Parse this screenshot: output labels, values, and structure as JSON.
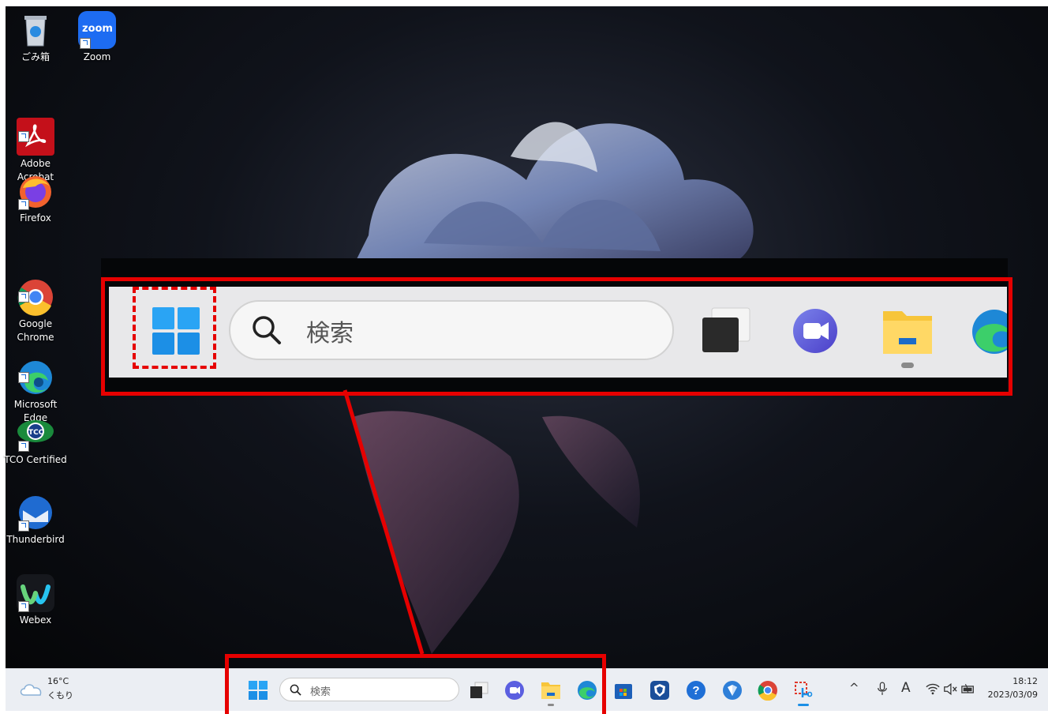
{
  "desktop_icons": [
    {
      "name": "recycle-bin",
      "label": "ごみ箱"
    },
    {
      "name": "zoom",
      "label": "Zoom",
      "badge": "zoom"
    },
    {
      "name": "adobe-acrobat",
      "label": "Adobe\nAcrobat"
    },
    {
      "name": "firefox",
      "label": "Firefox"
    },
    {
      "name": "google-chrome",
      "label": "Google\nChrome"
    },
    {
      "name": "microsoft-edge",
      "label": "Microsoft\nEdge"
    },
    {
      "name": "tco-certified",
      "label": "TCO Certified",
      "badge": "TCO"
    },
    {
      "name": "thunderbird",
      "label": "Thunderbird"
    },
    {
      "name": "webex",
      "label": "Webex"
    }
  ],
  "zoom_callout": {
    "search_placeholder": "検索",
    "icons": [
      "windows-start-icon",
      "search-icon",
      "task-view-icon",
      "teams-chat-icon",
      "file-explorer-icon",
      "edge-icon"
    ]
  },
  "taskbar": {
    "search_placeholder": "検索",
    "weather": {
      "temp": "16°C",
      "condition": "くもり"
    },
    "clock": {
      "time": "18:12",
      "date": "2023/03/09"
    },
    "ime_label": "A",
    "pinned": [
      "start",
      "task-view",
      "teams-chat",
      "file-explorer",
      "edge",
      "store",
      "vpn",
      "help",
      "defender",
      "chrome",
      "snipping"
    ],
    "tray": [
      "chevron-up-icon",
      "microphone-icon",
      "ime-icon",
      "wifi-icon",
      "speaker-icon",
      "battery-icon"
    ]
  },
  "colors": {
    "accent_red": "#e60000",
    "windows_blue": "#1c8fe6",
    "taskbar_bg": "#ebeef3"
  }
}
